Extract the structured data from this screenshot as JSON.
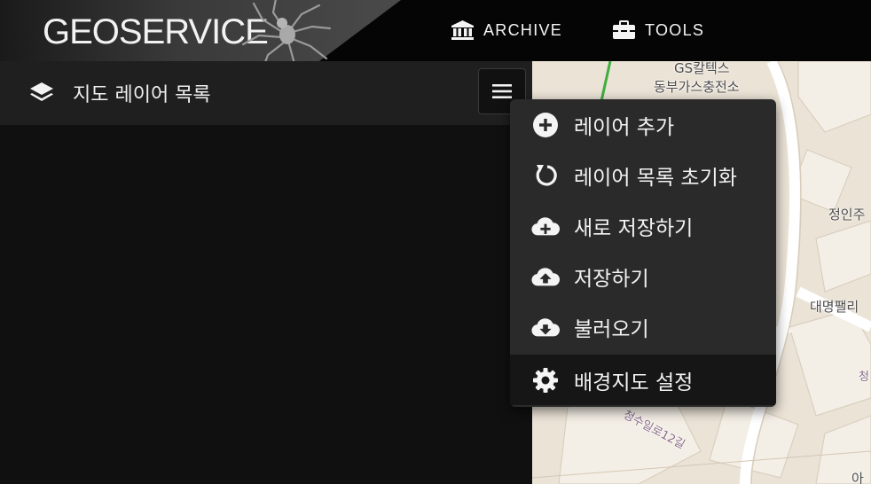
{
  "header": {
    "brand": "GEOSERVICE",
    "nav": [
      {
        "label": "ARCHIVE",
        "icon": "bank-icon"
      },
      {
        "label": "TOOLS",
        "icon": "toolbox-icon"
      }
    ]
  },
  "panel": {
    "title": "지도 레이어 목록",
    "icon": "layers-icon",
    "menu_button_icon": "hamburger-icon"
  },
  "dropdown": {
    "items": [
      {
        "label": "레이어 추가",
        "icon": "plus-circle-icon"
      },
      {
        "label": "레이어 목록 초기화",
        "icon": "reset-icon"
      },
      {
        "label": "새로 저장하기",
        "icon": "cloud-plus-icon"
      },
      {
        "label": "저장하기",
        "icon": "cloud-upload-icon"
      },
      {
        "label": "불러오기",
        "icon": "cloud-download-icon"
      },
      {
        "label": "배경지도 설정",
        "icon": "gear-icon",
        "active": true
      }
    ]
  },
  "map": {
    "labels": [
      "GS칼텍스",
      "동부가스충전소",
      "정인주",
      "대명팰리",
      "청수일로12길",
      "청",
      "아"
    ]
  },
  "colors": {
    "topbar": "#050505",
    "panel_header": "#1f1f1f",
    "dropdown_bg": "#2a2a2a",
    "dropdown_active": "#161616",
    "map_bg": "#ebe3d6"
  }
}
